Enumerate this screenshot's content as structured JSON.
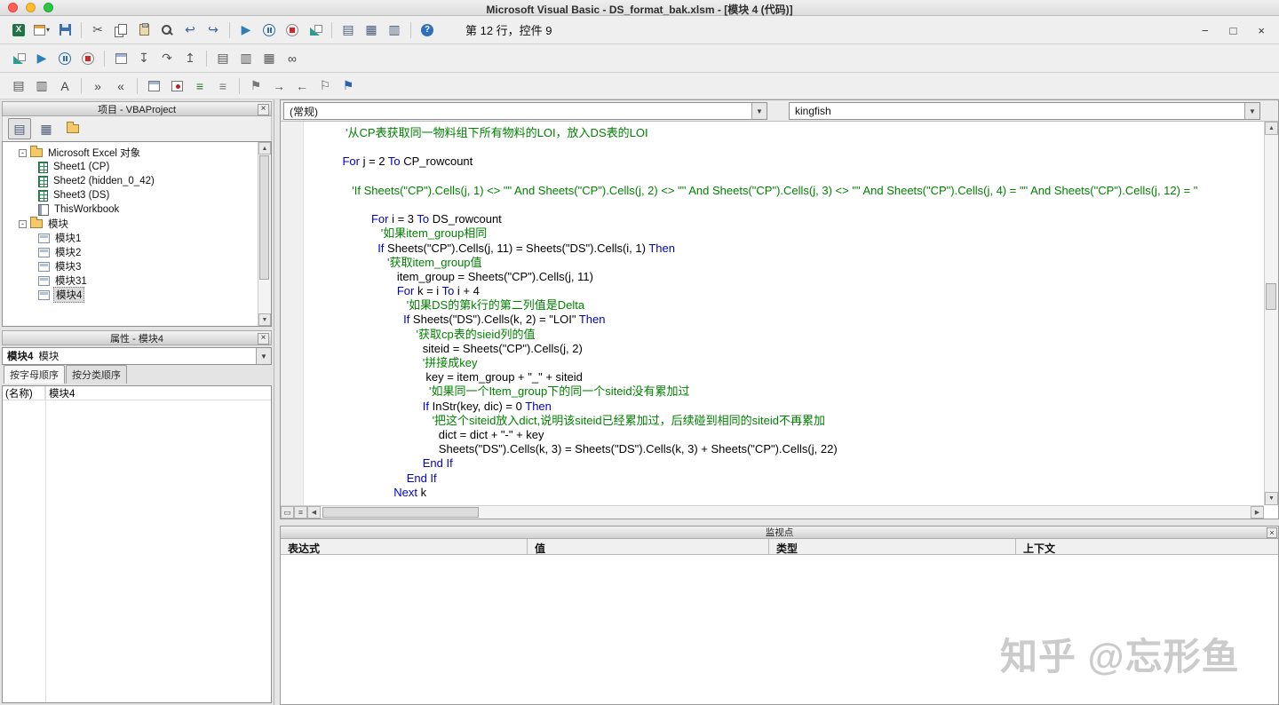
{
  "window": {
    "title": "Microsoft Visual Basic - DS_format_bak.xlsm - [模块 4 (代码)]",
    "controls": [
      "−",
      "□",
      "×"
    ]
  },
  "ui": {
    "close_glyph": "×",
    "up": "▲",
    "down": "▼",
    "left": "◀",
    "right": "▶",
    "proc_view_glyph": "▭",
    "full_view_glyph": "≡",
    "combo_arrow": "▼"
  },
  "toolbars": {
    "status": "第 12 行，控件 9",
    "main": [
      {
        "n": "excel-icon",
        "k": "excel"
      },
      {
        "n": "insert-userform-icon",
        "k": "css",
        "cls": "i-form",
        "dd": true
      },
      {
        "n": "save-icon",
        "k": "css",
        "cls": "i-save"
      },
      {
        "sep": true
      },
      {
        "n": "cut-icon",
        "k": "glyph",
        "g": "✂",
        "c": "#555555"
      },
      {
        "n": "copy-icon",
        "k": "css",
        "cls": "i-copy"
      },
      {
        "n": "paste-icon",
        "k": "css",
        "cls": "i-paste"
      },
      {
        "n": "find-icon",
        "k": "css",
        "cls": "i-find"
      },
      {
        "n": "undo-icon",
        "k": "glyph",
        "g": "↩",
        "c": "#3a5fa0"
      },
      {
        "n": "redo-icon",
        "k": "glyph",
        "g": "↪",
        "c": "#3a5fa0"
      },
      {
        "sep": true
      },
      {
        "n": "run-icon",
        "k": "glyph",
        "g": "▶",
        "c": "#2e7fb5"
      },
      {
        "n": "break-icon",
        "k": "css",
        "cls": "i-pause"
      },
      {
        "n": "reset-icon",
        "k": "css",
        "cls": "i-stop"
      },
      {
        "n": "design-mode-icon",
        "k": "css",
        "cls": "i-design"
      },
      {
        "sep": true
      },
      {
        "n": "project-explorer-icon",
        "k": "glyph",
        "g": "▤",
        "c": "#4a5a78"
      },
      {
        "n": "properties-window-icon",
        "k": "glyph",
        "g": "▦",
        "c": "#4a5a78"
      },
      {
        "n": "object-browser-icon",
        "k": "glyph",
        "g": "▥",
        "c": "#4a5a78"
      },
      {
        "sep": true
      },
      {
        "n": "help-icon",
        "k": "css",
        "cls": "i-help"
      }
    ],
    "debug": [
      {
        "n": "design-mode-icon",
        "k": "css",
        "cls": "i-design"
      },
      {
        "n": "run-icon",
        "k": "glyph",
        "g": "▶",
        "c": "#2e7fb5"
      },
      {
        "n": "break-icon",
        "k": "css",
        "cls": "i-pause"
      },
      {
        "n": "reset-icon",
        "k": "css",
        "cls": "i-stop"
      },
      {
        "sep": true
      },
      {
        "n": "hand-icon",
        "k": "css",
        "cls": "i-box"
      },
      {
        "n": "step-into-icon",
        "k": "glyph",
        "g": "↧",
        "c": "#555555"
      },
      {
        "n": "step-over-icon",
        "k": "glyph",
        "g": "↷",
        "c": "#555555"
      },
      {
        "n": "step-out-icon",
        "k": "glyph",
        "g": "↥",
        "c": "#555555"
      },
      {
        "sep": true
      },
      {
        "n": "locals-window-icon",
        "k": "glyph",
        "g": "▤",
        "c": "#555555"
      },
      {
        "n": "immediate-window-icon",
        "k": "glyph",
        "g": "▥",
        "c": "#555555"
      },
      {
        "n": "watch-window-icon",
        "k": "glyph",
        "g": "▦",
        "c": "#555555"
      },
      {
        "n": "quick-watch-icon",
        "k": "glyph",
        "g": "∞",
        "c": "#444444"
      }
    ],
    "edit": [
      {
        "n": "list-properties-icon",
        "k": "glyph",
        "g": "▤",
        "c": "#555555"
      },
      {
        "n": "list-constants-icon",
        "k": "glyph",
        "g": "▥",
        "c": "#555555"
      },
      {
        "n": "complete-word-icon",
        "k": "glyph",
        "g": "A",
        "c": "#444444"
      },
      {
        "sep": true
      },
      {
        "n": "indent-icon",
        "k": "glyph",
        "g": "»",
        "c": "#444444"
      },
      {
        "n": "outdent-icon",
        "k": "glyph",
        "g": "«",
        "c": "#444444"
      },
      {
        "sep": true
      },
      {
        "n": "hand-icon",
        "k": "css",
        "cls": "i-box"
      },
      {
        "n": "toggle-breakpoint-icon",
        "k": "css",
        "cls": "i-bp"
      },
      {
        "n": "comment-block-icon",
        "k": "glyph",
        "g": "≡",
        "c": "#2c7a2c"
      },
      {
        "n": "uncomment-block-icon",
        "k": "glyph",
        "g": "≡",
        "c": "#777777"
      },
      {
        "sep": true
      },
      {
        "n": "toggle-bookmark-icon",
        "k": "glyph",
        "g": "⚑",
        "c": "#777777"
      },
      {
        "n": "next-bookmark-icon",
        "k": "glyph",
        "g": "→",
        "c": "#555555"
      },
      {
        "n": "previous-bookmark-icon",
        "k": "glyph",
        "g": "←",
        "c": "#555555"
      },
      {
        "n": "clear-bookmarks-icon",
        "k": "glyph",
        "g": "⚐",
        "c": "#555555"
      },
      {
        "n": "bookmark-flag-icon",
        "k": "glyph",
        "g": "⚑",
        "c": "#2b5fb0"
      }
    ],
    "project_toolbar": [
      {
        "n": "view-code-icon",
        "k": "glyph",
        "g": "▤",
        "c": "#4a5a78",
        "pressed": true
      },
      {
        "n": "view-object-icon",
        "k": "glyph",
        "g": "▦",
        "c": "#4a5a78"
      },
      {
        "n": "toggle-folders-icon",
        "k": "css",
        "cls": "i-folder"
      }
    ]
  },
  "project_panel": {
    "title": "项目 - VBAProject",
    "items": [
      {
        "label": "Microsoft Excel 对象",
        "type": "folder",
        "depth": 0,
        "expander": "-"
      },
      {
        "label": "Sheet1 (CP)",
        "type": "sheet",
        "depth": 1
      },
      {
        "label": "Sheet2 (hidden_0_42)",
        "type": "sheet",
        "depth": 1
      },
      {
        "label": "Sheet3 (DS)",
        "type": "sheet",
        "depth": 1
      },
      {
        "label": "ThisWorkbook",
        "type": "workbook",
        "depth": 1
      },
      {
        "label": "模块",
        "type": "folder",
        "depth": 0,
        "expander": "-"
      },
      {
        "label": "模块1",
        "type": "module",
        "depth": 1
      },
      {
        "label": "模块2",
        "type": "module",
        "depth": 1
      },
      {
        "label": "模块3",
        "type": "module",
        "depth": 1
      },
      {
        "label": "模块31",
        "type": "module",
        "depth": 1
      },
      {
        "label": "模块4",
        "type": "module",
        "depth": 1,
        "selected": true
      }
    ]
  },
  "properties_panel": {
    "title": "属性 - 模块4",
    "selector_name": "模块4",
    "selector_type": "模块",
    "tabs": [
      "按字母顺序",
      "按分类顺序"
    ],
    "rows": [
      {
        "name": "(名称)",
        "value": "模块4"
      }
    ]
  },
  "code_pane": {
    "object_dropdown": "(常规)",
    "procedure_dropdown": "kingfish",
    "colors": {
      "comment": "#008200",
      "keyword": "#0000C8",
      "normal": "#000000"
    },
    "lines": [
      [
        [
          "c",
          "     '从CP表获取同一物料组下所有物料的LOI，放入DS表的LOI"
        ]
      ],
      [],
      [
        [
          "n",
          "    "
        ],
        [
          "k",
          "For"
        ],
        [
          "n",
          " j = 2 "
        ],
        [
          "k",
          "To"
        ],
        [
          "n",
          " CP_rowcount"
        ]
      ],
      [],
      [
        [
          "c",
          "       'If Sheets(\"CP\").Cells(j, 1) <> \"\" And Sheets(\"CP\").Cells(j, 2) <> \"\" And Sheets(\"CP\").Cells(j, 3) <> \"\" And Sheets(\"CP\").Cells(j, 4) = \"\" And Sheets(\"CP\").Cells(j, 12) = \""
        ]
      ],
      [],
      [
        [
          "n",
          "             "
        ],
        [
          "k",
          "For"
        ],
        [
          "n",
          " i = 3 "
        ],
        [
          "k",
          "To"
        ],
        [
          "n",
          " DS_rowcount"
        ]
      ],
      [
        [
          "c",
          "                '如果item_group相同"
        ]
      ],
      [
        [
          "n",
          "               "
        ],
        [
          "k",
          "If"
        ],
        [
          "n",
          " Sheets(\"CP\").Cells(j, 11) = Sheets(\"DS\").Cells(i, 1) "
        ],
        [
          "k",
          "Then"
        ]
      ],
      [
        [
          "c",
          "                  '获取item_group值"
        ]
      ],
      [
        [
          "n",
          "                     item_group = Sheets(\"CP\").Cells(j, 11)"
        ]
      ],
      [
        [
          "n",
          "                     "
        ],
        [
          "k",
          "For"
        ],
        [
          "n",
          " k = i "
        ],
        [
          "k",
          "To"
        ],
        [
          "n",
          " i + 4"
        ]
      ],
      [
        [
          "c",
          "                        '如果DS的第k行的第二列值是Delta"
        ]
      ],
      [
        [
          "n",
          "                       "
        ],
        [
          "k",
          "If"
        ],
        [
          "n",
          " Sheets(\"DS\").Cells(k, 2) = \"LOI\" "
        ],
        [
          "k",
          "Then"
        ]
      ],
      [
        [
          "c",
          "                           '获取cp表的sieid列的值"
        ]
      ],
      [
        [
          "n",
          "                             siteid = Sheets(\"CP\").Cells(j, 2)"
        ]
      ],
      [
        [
          "c",
          "                             '拼接成key"
        ]
      ],
      [
        [
          "n",
          "                              key = item_group + \"_\" + siteid"
        ]
      ],
      [
        [
          "c",
          "                               '如果同一个Item_group下的同一个siteid没有累加过"
        ]
      ],
      [
        [
          "n",
          "                             "
        ],
        [
          "k",
          "If"
        ],
        [
          "n",
          " InStr(key, dic) = 0 "
        ],
        [
          "k",
          "Then"
        ]
      ],
      [
        [
          "c",
          "                                '把这个siteid放入dict,说明该siteid已经累加过，后续碰到相同的siteid不再累加"
        ]
      ],
      [
        [
          "n",
          "                                  dict = dict + \"-\" + key"
        ]
      ],
      [
        [
          "n",
          "                                  Sheets(\"DS\").Cells(k, 3) = Sheets(\"DS\").Cells(k, 3) + Sheets(\"CP\").Cells(j, 22)"
        ]
      ],
      [
        [
          "n",
          "                             "
        ],
        [
          "k",
          "End If"
        ]
      ],
      [
        [
          "n",
          "                        "
        ],
        [
          "k",
          "End If"
        ]
      ],
      [
        [
          "n",
          "                    "
        ],
        [
          "k",
          "Next"
        ],
        [
          "n",
          " k"
        ]
      ]
    ]
  },
  "watch_panel": {
    "title": "监视点",
    "columns": [
      "表达式",
      "值",
      "类型",
      "上下文"
    ]
  },
  "watermark": {
    "text": "知乎 @忘形鱼"
  }
}
